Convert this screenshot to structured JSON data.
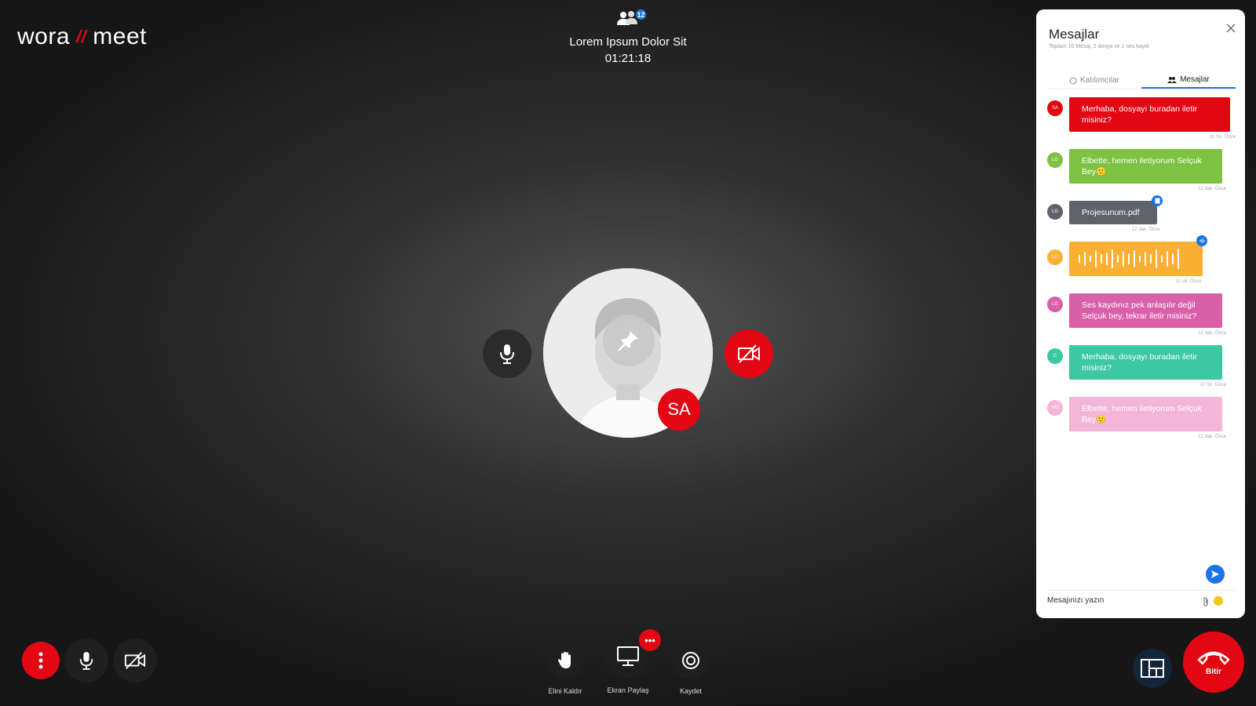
{
  "brand": {
    "left": "wora",
    "separator": "//",
    "right": "meet"
  },
  "meeting": {
    "participants_count": "12",
    "title": "Lorem Ipsum Dolor Sit",
    "elapsed": "01:21:18"
  },
  "speaker": {
    "initials": "SA"
  },
  "toolbar": {
    "raise_hand_label": "Elini Kaldır",
    "screen_share_label": "Ekran Paylaş",
    "screen_share_more": "•••",
    "record_label": "Kaydet",
    "end_call_label": "Bitir"
  },
  "chat": {
    "title": "Mesajlar",
    "subtitle": "Toplam 16 Mesaj, 2 dosya ve 1 ses kaydı",
    "tabs": [
      {
        "label": "Katılımcılar"
      },
      {
        "label": "Mesajlar",
        "active": true
      }
    ],
    "messages": [
      {
        "initials": "SA",
        "color": "#e30613",
        "text": "Merhaba, dosyayı buradan iletir misiniz?",
        "time": "10 Sn. Önce",
        "type": "text"
      },
      {
        "initials": "LG",
        "color": "#7dc242",
        "text": "Elbette, hemen iletiyorum Selçuk Bey🙂",
        "time": "12 dak. Önce",
        "type": "text"
      },
      {
        "initials": "LG",
        "color": "#5f6368",
        "text": "Projesunum.pdf",
        "time": "12 dak. Önce",
        "type": "file"
      },
      {
        "initials": "LG",
        "color": "#fbb033",
        "text": "",
        "time": "37 dk. Önce",
        "type": "audio"
      },
      {
        "initials": "LG",
        "color": "#d960a8",
        "text": "Ses kaydınız pek anlaşılır değil Selçuk bey, tekrar iletir misiniz?",
        "time": "12 dak. Önce",
        "type": "text"
      },
      {
        "initials": "C",
        "color": "#3cc8a0",
        "text": "Merhaba, dosyayı buradan iletir misiniz?",
        "time": "10 Sn. Önce",
        "type": "text"
      },
      {
        "initials": "VG",
        "color": "#f3b6d8",
        "text": "Elbette, hemen iletiyorum Selçuk Bey🙂",
        "time": "12 dak. Önce",
        "type": "text"
      }
    ],
    "input_placeholder": "Mesajınızı yazın"
  },
  "colors": {
    "brand_red": "#e30613",
    "accent_blue": "#1a73e8"
  }
}
